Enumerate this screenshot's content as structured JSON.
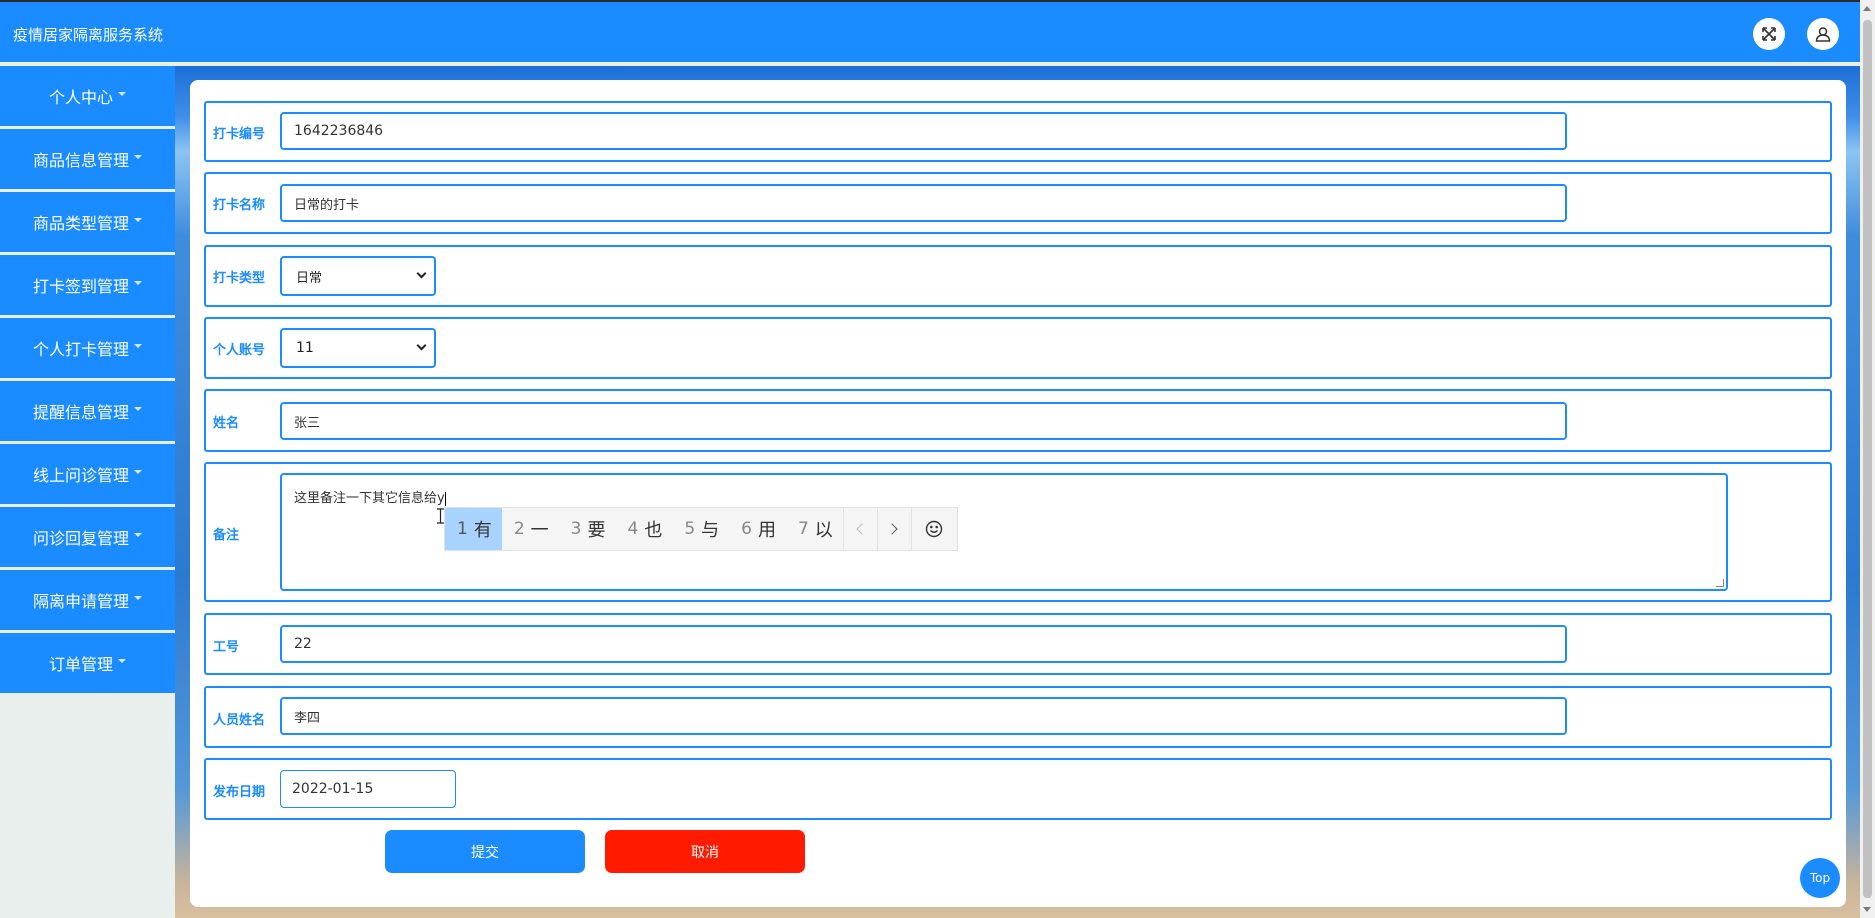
{
  "app": {
    "title": "疫情居家隔离服务系统"
  },
  "header_icons": {
    "fullscreen": "fullscreen-icon",
    "user": "user-icon"
  },
  "sidebar": {
    "items": [
      {
        "label": "个人中心"
      },
      {
        "label": "商品信息管理"
      },
      {
        "label": "商品类型管理"
      },
      {
        "label": "打卡签到管理"
      },
      {
        "label": "个人打卡管理"
      },
      {
        "label": "提醒信息管理"
      },
      {
        "label": "线上问诊管理"
      },
      {
        "label": "问诊回复管理"
      },
      {
        "label": "隔离申请管理"
      },
      {
        "label": "订单管理"
      }
    ]
  },
  "form": {
    "checkin_no": {
      "label": "打卡编号",
      "value": "1642236846"
    },
    "checkin_name": {
      "label": "打卡名称",
      "value": "日常的打卡"
    },
    "checkin_type": {
      "label": "打卡类型",
      "value": "日常"
    },
    "account": {
      "label": "个人账号",
      "value": "11"
    },
    "name": {
      "label": "姓名",
      "value": "张三"
    },
    "remark": {
      "label": "备注",
      "value": "这里备注一下其它信息给y"
    },
    "staff_no": {
      "label": "工号",
      "value": "22"
    },
    "staff_name": {
      "label": "人员姓名",
      "value": "李四"
    },
    "publish_date": {
      "label": "发布日期",
      "value": "2022-01-15"
    }
  },
  "ime": {
    "candidates": [
      {
        "num": "1",
        "text": "有"
      },
      {
        "num": "2",
        "text": "一"
      },
      {
        "num": "3",
        "text": "要"
      },
      {
        "num": "4",
        "text": "也"
      },
      {
        "num": "5",
        "text": "与"
      },
      {
        "num": "6",
        "text": "用"
      },
      {
        "num": "7",
        "text": "以"
      }
    ]
  },
  "buttons": {
    "submit": "提交",
    "cancel": "取消",
    "top": "Top"
  },
  "colors": {
    "primary": "#1a8cff",
    "danger": "#ff1a00"
  }
}
